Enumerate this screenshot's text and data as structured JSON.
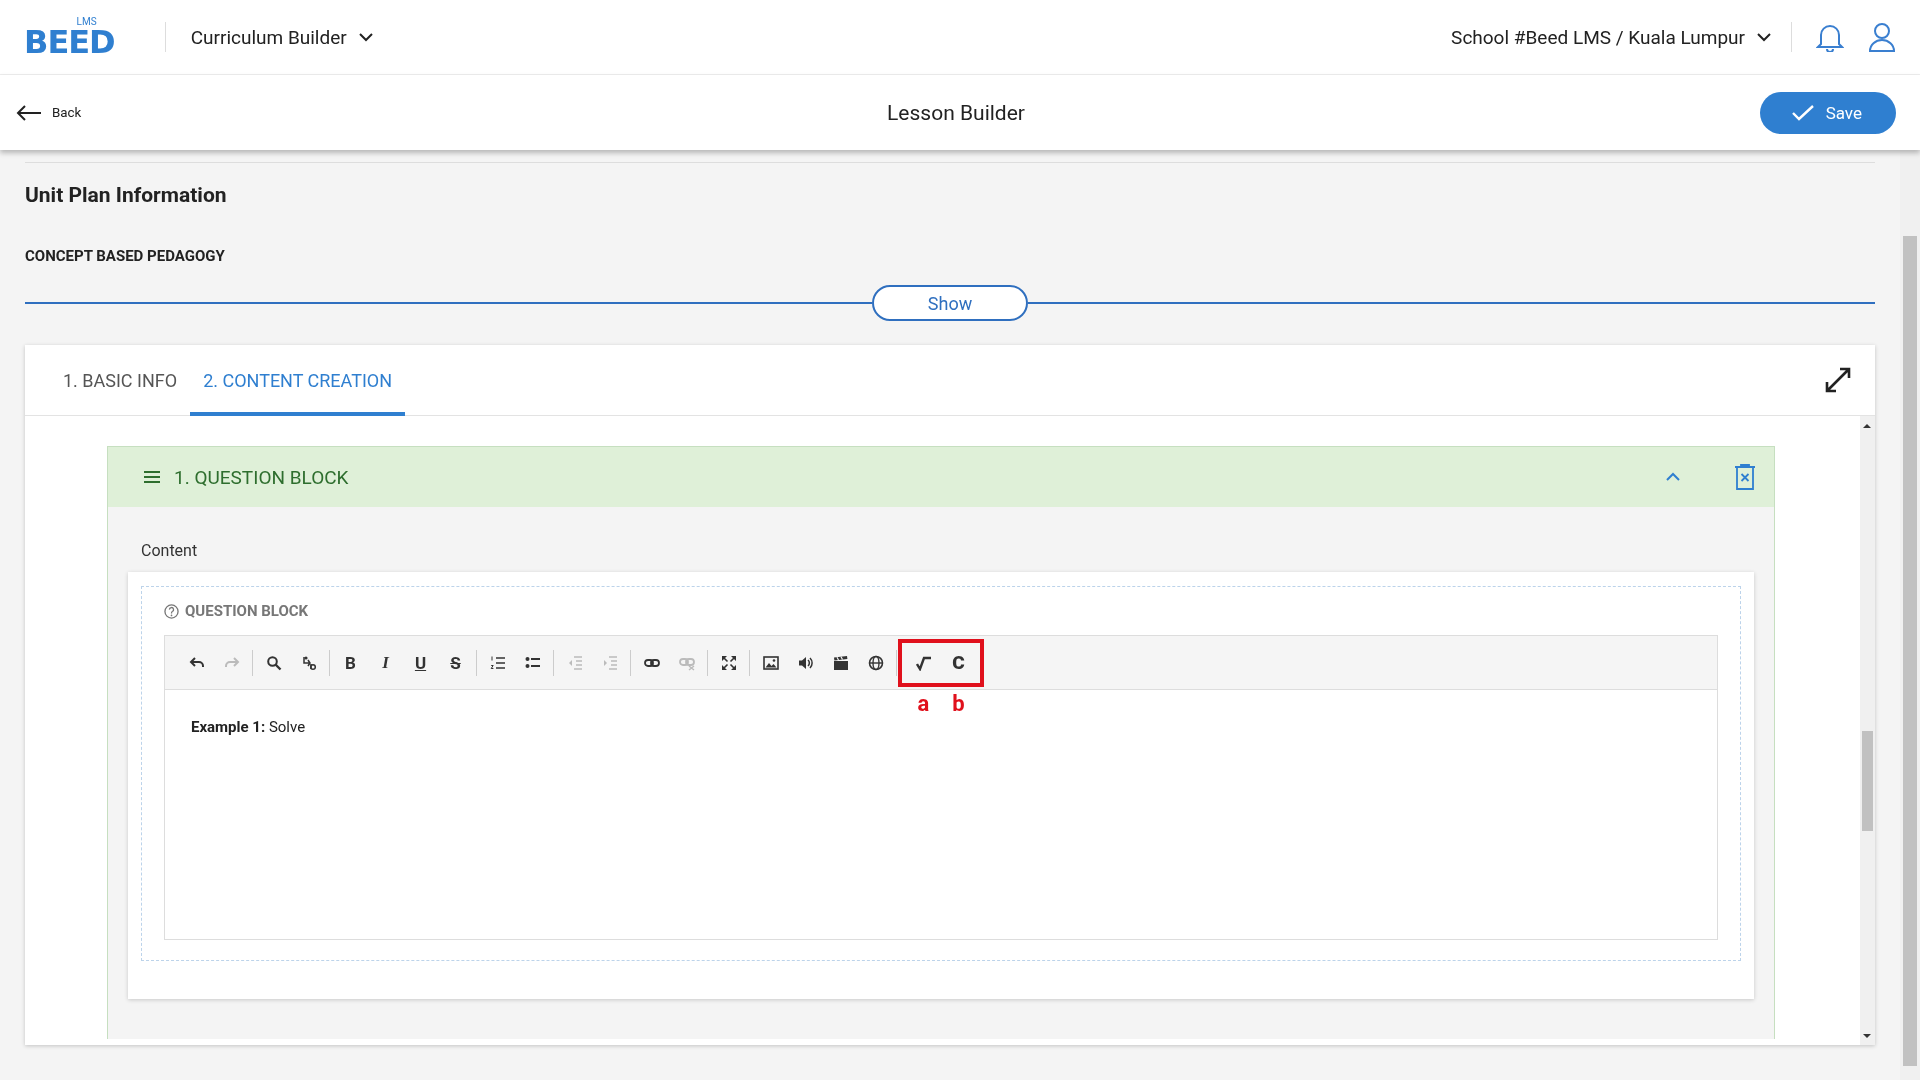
{
  "header": {
    "logo_top": "LMS",
    "logo": "BEED",
    "module": "Curriculum Builder",
    "school": "School #Beed LMS / Kuala Lumpur"
  },
  "subheader": {
    "back": "Back",
    "title": "Lesson Builder",
    "save": "Save"
  },
  "unit_plan": {
    "title": "Unit Plan Information",
    "subtitle": "CONCEPT BASED PEDAGOGY",
    "toggle": "Show"
  },
  "tabs": [
    {
      "label": "1. BASIC INFO",
      "selected": false
    },
    {
      "label": "2. CONTENT CREATION",
      "selected": true
    }
  ],
  "block": {
    "title": "1. QUESTION BLOCK",
    "expanded": true,
    "content_label": "Content",
    "editor_title": "QUESTION BLOCK",
    "toolbar": [
      [
        {
          "kind": "undo",
          "disabled": false
        },
        {
          "kind": "redo",
          "disabled": true
        }
      ],
      [
        {
          "kind": "search",
          "disabled": false
        },
        {
          "kind": "replace",
          "disabled": false
        }
      ],
      [
        {
          "kind": "bold",
          "label": "B",
          "disabled": false
        },
        {
          "kind": "italic",
          "label": "I",
          "disabled": false
        },
        {
          "kind": "underline",
          "label": "U",
          "disabled": false
        },
        {
          "kind": "strike",
          "label": "S",
          "disabled": false
        }
      ],
      [
        {
          "kind": "ordered-list",
          "disabled": false
        },
        {
          "kind": "bullet-list",
          "disabled": false
        }
      ],
      [
        {
          "kind": "outdent",
          "disabled": true
        },
        {
          "kind": "indent",
          "disabled": true
        }
      ],
      [
        {
          "kind": "link",
          "disabled": false
        },
        {
          "kind": "unlink",
          "disabled": true
        }
      ],
      [
        {
          "kind": "fullscreen",
          "disabled": false
        }
      ],
      [
        {
          "kind": "image",
          "disabled": false
        },
        {
          "kind": "audio",
          "disabled": false
        },
        {
          "kind": "video",
          "disabled": false
        },
        {
          "kind": "globe",
          "disabled": false
        }
      ],
      [
        {
          "kind": "math",
          "disabled": false,
          "annotation": "a"
        },
        {
          "kind": "chemistry",
          "label": "C",
          "disabled": false,
          "annotation": "b"
        }
      ]
    ],
    "body": "**Example 1:** Solve"
  }
}
